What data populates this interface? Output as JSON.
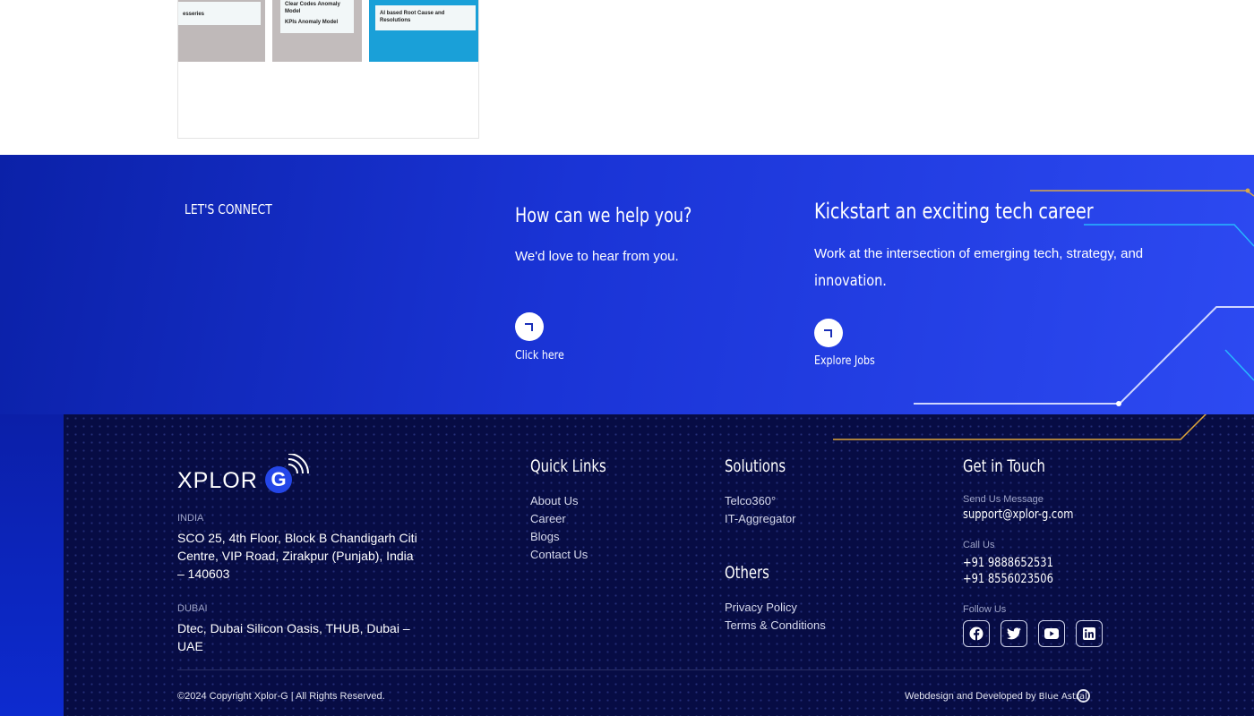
{
  "card": {
    "tiles": [
      {
        "label": "esseries"
      },
      {
        "label": "Clear Codes Anomaly Model",
        "label2": "KPIs Anomaly Model"
      },
      {
        "label": "AI based Root Cause and Resolutions"
      }
    ]
  },
  "connect": {
    "lets_connect": "LET'S CONNECT",
    "help_title": "How can we help you?",
    "help_subtitle": "We'd love to hear from you.",
    "help_cta": "Click here",
    "career_title": "Kickstart an exciting tech career",
    "career_subtitle_1": "Work at the intersection of emerging tech, strategy, and",
    "career_subtitle_2": "innovation.",
    "career_cta": "Explore Jobs"
  },
  "footer": {
    "logo_text": "XPLOR",
    "logo_g": "G",
    "india_label": "INDIA",
    "india_address": "SCO 25, 4th Floor, Block B Chandigarh Citi Centre, VIP Road, Zirakpur (Punjab), India – 140603",
    "dubai_label": "DUBAI",
    "dubai_address": "Dtec, Dubai Silicon Oasis, THUB, Dubai – UAE",
    "quick_links_title": "Quick Links",
    "quick_links": [
      "About Us",
      "Career",
      "Blogs",
      "Contact Us"
    ],
    "solutions_title": "Solutions",
    "solutions": [
      "Telco360°",
      "IT-Aggregator"
    ],
    "others_title": "Others",
    "others": [
      "Privacy Policy",
      "Terms & Conditions"
    ],
    "touch_title": "Get in Touch",
    "send_label": "Send Us Message",
    "email": "support@xplor-g.com",
    "call_label": "Call Us",
    "phone1": "+91 9888652531",
    "phone2": "+91 8556023506",
    "follow_label": "Follow Us",
    "social_icons": [
      "facebook-icon",
      "twitter-icon",
      "youtube-icon",
      "linkedin-icon"
    ],
    "copyright": "©2024 Copyright Xplor-G | All Rights Reserved.",
    "credit_text": "Webdesign and Developed by",
    "credit_brand": "Blue Astral"
  },
  "colors": {
    "band_start": "#0b21a8",
    "band_end": "#2d4af2",
    "footer_bg": "#070c44",
    "accent_gold": "#e0a63a"
  }
}
